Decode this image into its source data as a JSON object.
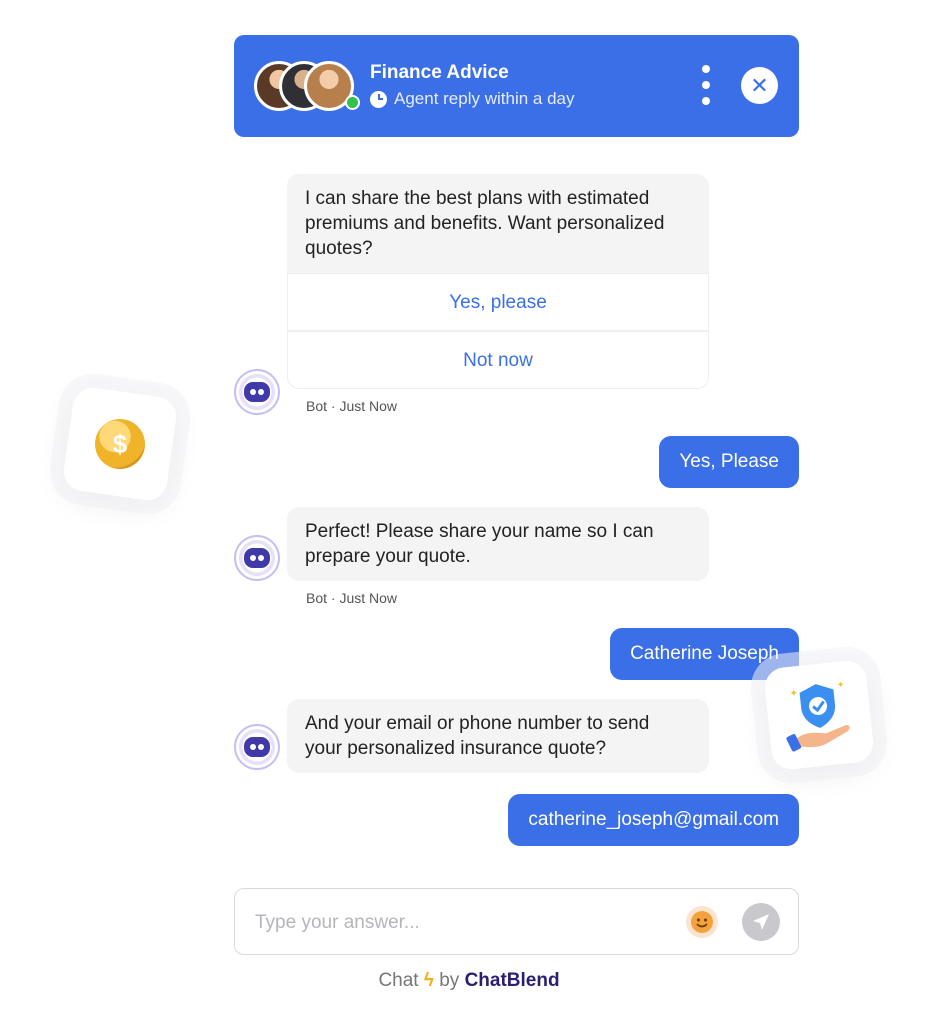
{
  "header": {
    "title": "Finance Advice",
    "subtitle": "Agent reply within a day",
    "avatars": [
      "avatar-woman",
      "avatar-man",
      "avatar-woman-2"
    ],
    "status": "online",
    "accent_color": "#3b6fe8"
  },
  "messages": {
    "bot1": {
      "text": "I can share the best plans with estimated premiums and benefits. Want personalized quotes?",
      "options": [
        "Yes, please",
        "Not now"
      ],
      "meta": "Bot · Just Now"
    },
    "user1": {
      "text": "Yes, Please"
    },
    "bot2": {
      "text": "Perfect! Please share your name so I can prepare your quote.",
      "meta": "Bot · Just Now"
    },
    "user2": {
      "text": "Catherine Joseph"
    },
    "bot3": {
      "text": "And your email or phone number to send your personalized insurance quote?"
    },
    "user3": {
      "text": "catherine_joseph@gmail.com"
    }
  },
  "composer": {
    "placeholder": "Type your answer...",
    "icons": [
      "smile-icon",
      "send-icon"
    ]
  },
  "footer": {
    "prefix": "Chat",
    "by": "by",
    "brand": "ChatBlend"
  },
  "decorations": [
    "coin-icon",
    "shield-hand-icon"
  ]
}
